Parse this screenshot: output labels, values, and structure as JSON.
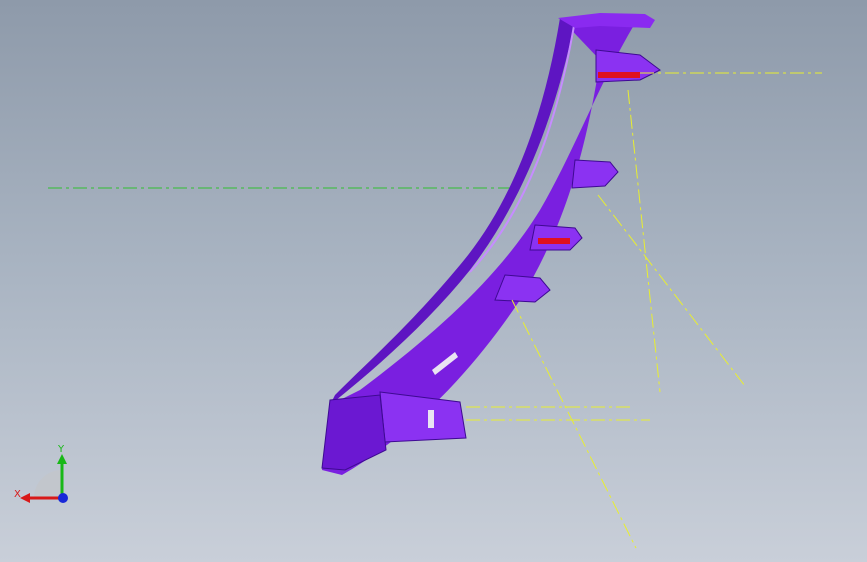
{
  "app": {
    "window_title": ""
  },
  "viewport": {
    "background_top": "#8e9aaa",
    "background_bottom": "#c9cfd9"
  },
  "model": {
    "part_color": "#7a1fe0",
    "part_dark": "#4a0ea8",
    "part_light": "#a056ff",
    "highlight_color": "#e01020"
  },
  "reference_lines": {
    "centerline_color": "#e8ee30",
    "plane_line_color": "#30c030"
  },
  "triad": {
    "x_label": "X",
    "y_label": "Y",
    "x_color": "#d81818",
    "y_color": "#18b818",
    "z_color": "#1828d8"
  }
}
